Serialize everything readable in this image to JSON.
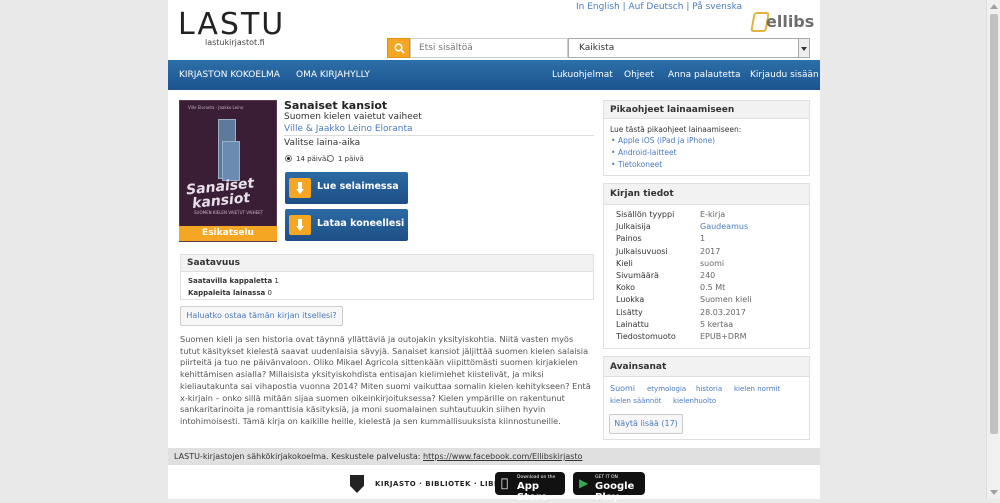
{
  "header": {
    "logo_text": "LASTU",
    "logo_sub": "lastukirjastot.fi",
    "lang_links": [
      "In English",
      "Auf Deutsch",
      "På svenska"
    ],
    "partner_logo": "ellibs",
    "search_placeholder": "Etsi sisältöä",
    "search_scope": "Kaikista"
  },
  "nav": {
    "left": [
      "KIRJASTON KOKOELMA",
      "OMA KIRJAHYLLY"
    ],
    "right": [
      "Lukuohjelmat",
      "Ohjeet",
      "Anna palautetta",
      "Kirjaudu sisään"
    ]
  },
  "book": {
    "cover_top": "Ville Eloranta · Jaakko Leino",
    "cover_title_1": "Sanaiset",
    "cover_title_2": "kansiot",
    "cover_sub": "SUOMEN KIELEN VAIETUT VAIHEET",
    "preview_label": "Esikatselu",
    "title": "Sanaiset kansiot",
    "subtitle": "Suomen kielen vaietut vaiheet",
    "authors": "Ville & Jaakko Leino Eloranta",
    "period_label": "Valitse laina-aika",
    "period_options": [
      "14 päivää",
      "1 päivä"
    ],
    "period_selected": 0,
    "read_button": "Lue selaimessa",
    "download_button": "Lataa koneellesi"
  },
  "availability": {
    "heading": "Saatavuus",
    "rows": [
      {
        "label": "Saatavilla kappaletta",
        "value": "1"
      },
      {
        "label": "Kappaleita lainassa",
        "value": "0"
      }
    ]
  },
  "buy_button": "Haluatko ostaa tämän kirjan itsellesi?",
  "description": "Suomen kieli ja sen historia ovat täynnä yllättäviä ja outojakin yksityiskohtia. Niitä vasten myös tutut käsitykset kielestä saavat uudenlaisia sävyjä. Sanaiset kansiot jäljittää suomen kielen salaisia piirteitä ja tuo ne päivänvaloon. Oliko Mikael Agricola sittenkään viipittömästi suomen kirjakielen kehittämisen asialla? Millaisista yksityiskohdista entisajan kielimiehet kiistelivät, ja miksi kieliautakunta sai vihapostia vuonna 2014? Miten suomi vaikuttaa somalin kielen kehitykseen? Entä x-kirjain – onko sillä mitään sijaa suomen oikeinkirjoituksessa? Kielen ympärille on rakentunut sankaritarinoita ja romanttisia käsityksiä, ja moni suomalainen suhtautuukin siihen hyvin intohimoisesti. Tämä kirja on kaikille heille, kielestä ja sen kummallisuuksista kiinnostuneille.",
  "quick_help": {
    "heading": "Pikaohjeet lainaamiseen",
    "intro": "Lue tästä pikaohjeet lainaamiseen:",
    "items": [
      "Apple iOS (iPad ja iPhone)",
      "Android-laitteet",
      "Tietokoneet"
    ]
  },
  "book_info": {
    "heading": "Kirjan tiedot",
    "rows": [
      {
        "k": "Sisällön tyyppi",
        "v": "E-kirja"
      },
      {
        "k": "Julkaisija",
        "v": "Gaudeamus"
      },
      {
        "k": "Painos",
        "v": "1"
      },
      {
        "k": "Julkaisuvuosi",
        "v": "2017"
      },
      {
        "k": "Kieli",
        "v": "suomi"
      },
      {
        "k": "Sivumäärä",
        "v": "240"
      },
      {
        "k": "Koko",
        "v": "0.5 Mt"
      },
      {
        "k": "Luokka",
        "v": "Suomen kieli"
      },
      {
        "k": "Lisätty",
        "v": "28.03.2017"
      },
      {
        "k": "Lainattu",
        "v": "5 kertaa"
      },
      {
        "k": "Tiedostomuoto",
        "v": "EPUB+DRM"
      }
    ]
  },
  "keywords": {
    "heading": "Avainsanat",
    "tags": [
      "Suomi",
      "etymologia",
      "historia",
      "kielen normit",
      "kielen säännöt",
      "kielenhuolto"
    ],
    "more_button": "Näytä lisää (17)"
  },
  "footer": {
    "text": "LASTU-kirjastojen sähkökirjakokoelma. Keskustele palvelusta: ",
    "link": "https://www.facebook.com/Ellibskirjasto",
    "kbl_text": "KIRJASTO · BIBLIOTEK · LIBRARY",
    "appstore_small": "Download on the",
    "appstore_big": "App Store",
    "googleplay_small": "GET IT ON",
    "googleplay_big": "Google Play"
  }
}
